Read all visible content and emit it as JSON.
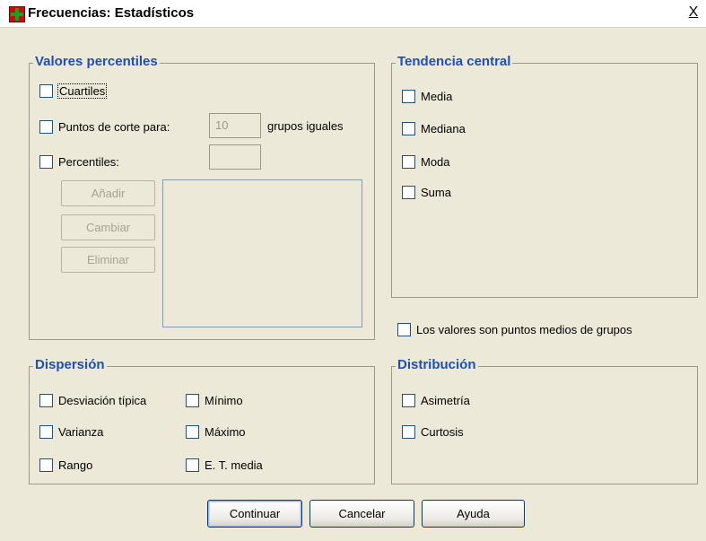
{
  "window": {
    "title": "Frecuencias: Estadísticos",
    "close_glyph": "X"
  },
  "percentiles": {
    "legend": "Valores percentiles",
    "quartiles": "Cuartiles",
    "cut_points": "Puntos de corte para:",
    "cut_points_value": "10",
    "equal_groups": "grupos iguales",
    "percentiles": "Percentiles:",
    "percentile_value": "",
    "add": "Añadir",
    "change": "Cambiar",
    "remove": "Eliminar"
  },
  "central": {
    "legend": "Tendencia central",
    "mean": "Media",
    "median": "Mediana",
    "mode": "Moda",
    "sum": "Suma"
  },
  "midpoints": "Los valores son puntos medios de grupos",
  "dispersion": {
    "legend": "Dispersión",
    "std": "Desviación típica",
    "min": "Mínimo",
    "variance": "Varianza",
    "max": "Máximo",
    "range": "Rango",
    "se_mean": "E. T. media"
  },
  "distribution": {
    "legend": "Distribución",
    "skewness": "Asimetría",
    "kurtosis": "Curtosis"
  },
  "buttons": {
    "continue": "Continuar",
    "cancel": "Cancelar",
    "help": "Ayuda"
  }
}
